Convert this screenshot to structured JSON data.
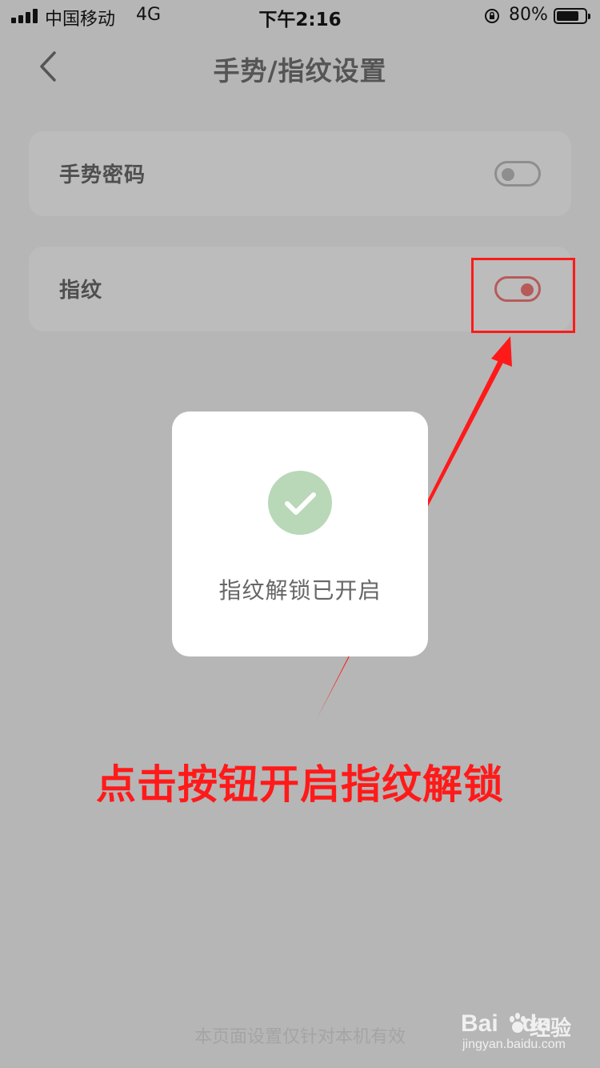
{
  "status_bar": {
    "carrier": "中国移动",
    "network": "4G",
    "time": "下午2:16",
    "battery": "80%"
  },
  "nav": {
    "title": "手势/指纹设置"
  },
  "settings": [
    {
      "label": "手势密码",
      "enabled": false
    },
    {
      "label": "指纹",
      "enabled": true
    }
  ],
  "toast": {
    "message": "指纹解锁已开启"
  },
  "annotation": {
    "text": "点击按钮开启指纹解锁"
  },
  "footer": {
    "note": "本页面设置仅针对本机有效"
  },
  "watermark": {
    "brand": "Bai",
    "brand_suffix": "du",
    "name": "经验",
    "url": "jingyan.baidu.com"
  },
  "colors": {
    "toggle_on": "#b85a5a",
    "toggle_off": "#8e8e8e",
    "annotation": "#ff1a1a",
    "success": "#b8d8b8"
  }
}
